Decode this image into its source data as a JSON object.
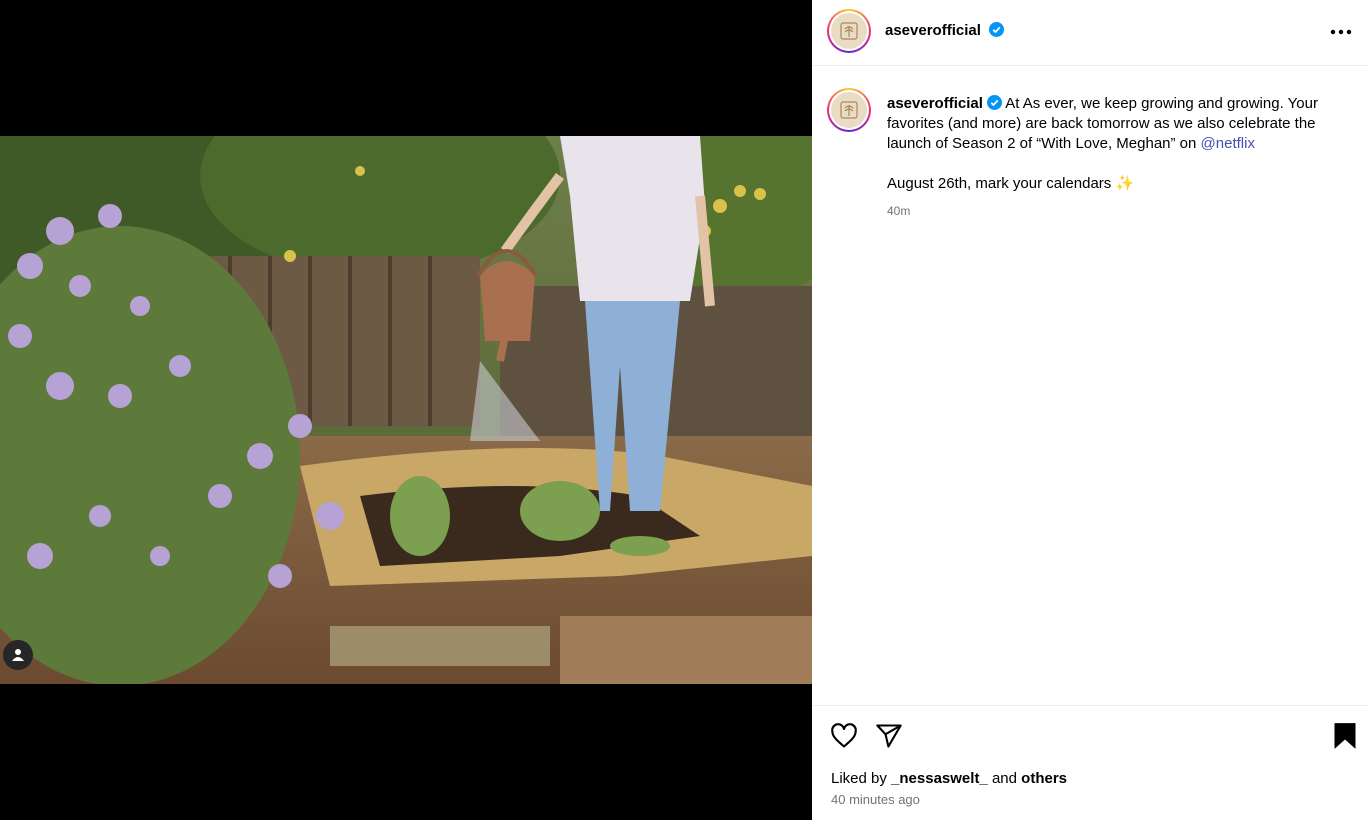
{
  "post": {
    "username": "aseverofficial",
    "verified": true,
    "caption": {
      "text_before": "At As ever, we keep growing and growing. Your favorites (and more) are back tomorrow as we also celebrate the launch of Season 2 of “With Love, Meghan” on ",
      "mention": "@netflix",
      "line2": "August 26th, mark your calendars ✨",
      "time": "40m"
    },
    "likes": {
      "prefix": "Liked by",
      "liker": "_nessaswelt_",
      "conjunction": "and",
      "others": "others"
    },
    "timestamp": "40 minutes ago"
  },
  "icons": {
    "more": "more-options-icon",
    "like": "heart-icon",
    "share": "send-icon",
    "save": "bookmark-filled-icon",
    "tag": "user-tag-icon"
  },
  "colors": {
    "verified": "#0095f6",
    "mention": "#4150b4",
    "muted": "#737373"
  }
}
